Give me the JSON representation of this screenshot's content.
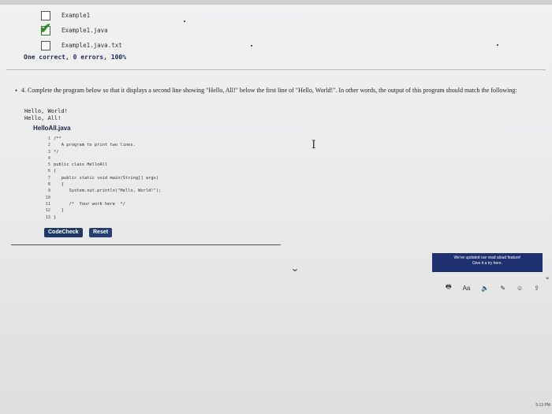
{
  "files": [
    {
      "name": "Example1",
      "checked": false
    },
    {
      "name": "Example1.java",
      "checked": true
    },
    {
      "name": "Example1.java.txt",
      "checked": false
    }
  ],
  "summary": "One correct, 0 errors, 100%",
  "question": {
    "number": "4.",
    "text": "Complete the program below so that it displays a second line showing \"Hello, All!\" below the first line of \"Hello, World!\". In other words, the output of this program should match the following:"
  },
  "expected_output": "Hello, World!\nHello, All!",
  "file_name": "HelloAll.java",
  "code": [
    {
      "n": "1",
      "text": "/**"
    },
    {
      "n": "2",
      "text": "   A program to print two lines."
    },
    {
      "n": "3",
      "text": "*/"
    },
    {
      "n": "4",
      "text": ""
    },
    {
      "n": "5",
      "text": "public class HelloAll"
    },
    {
      "n": "6",
      "text": "{"
    },
    {
      "n": "7",
      "text": "   public static void main(String[] args)"
    },
    {
      "n": "8",
      "text": "   {"
    },
    {
      "n": "9",
      "text": "      System.out.println(\"Hello, World!\");"
    },
    {
      "n": "10",
      "text": ""
    },
    {
      "n": "11",
      "text": "      /*  Your work here  */"
    },
    {
      "n": "12",
      "text": "   }"
    },
    {
      "n": "13",
      "text": "}"
    }
  ],
  "buttons": {
    "codecheck": "CodeCheck",
    "reset": "Reset"
  },
  "banner": {
    "line1": "We've updated our read aloud feature!",
    "line2": "Give it a try here."
  },
  "reader": {
    "print": "🖶",
    "aa": "Aa",
    "speaker": "🔈",
    "pen": "✎",
    "smile": "☺",
    "share": "⇪"
  },
  "clock": "5:13 PM"
}
